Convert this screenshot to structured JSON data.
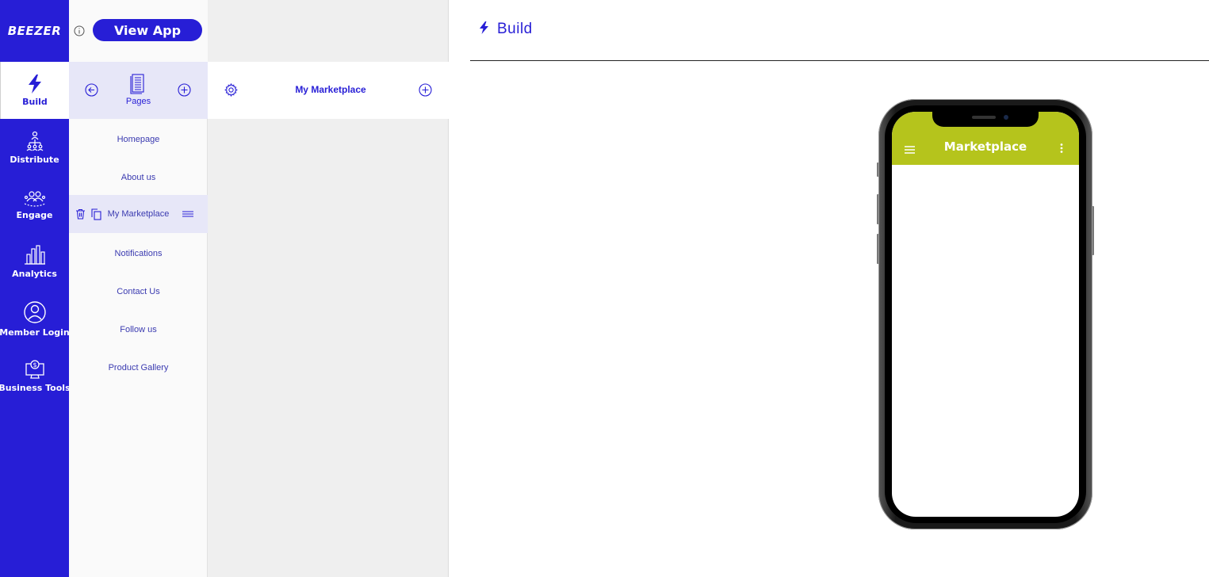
{
  "nav": {
    "logo": "BEEZER",
    "items": [
      {
        "label": "Build",
        "icon": "bolt-icon",
        "active": true
      },
      {
        "label": "Distribute",
        "icon": "distribute-icon"
      },
      {
        "label": "Engage",
        "icon": "people-icon"
      },
      {
        "label": "Analytics",
        "icon": "bar-chart-icon"
      },
      {
        "label": "Member Login",
        "icon": "user-icon"
      },
      {
        "label": "Business Tools",
        "icon": "monitor-dollar-icon"
      }
    ]
  },
  "topbar": {
    "view_app_label": "View App"
  },
  "pages": {
    "header_label": "Pages",
    "items": [
      {
        "label": "Homepage"
      },
      {
        "label": "About us"
      },
      {
        "label": "My Marketplace",
        "selected": true
      },
      {
        "label": "Notifications"
      },
      {
        "label": "Contact Us"
      },
      {
        "label": "Follow us"
      },
      {
        "label": "Product Gallery"
      }
    ]
  },
  "subpage": {
    "title": "My Marketplace"
  },
  "main": {
    "title": "Build"
  },
  "phone": {
    "app_title": "Marketplace",
    "app_bar_color": "#b5c41c"
  },
  "colors": {
    "brand": "#271ed6",
    "accent_light": "#e7e7f8"
  }
}
